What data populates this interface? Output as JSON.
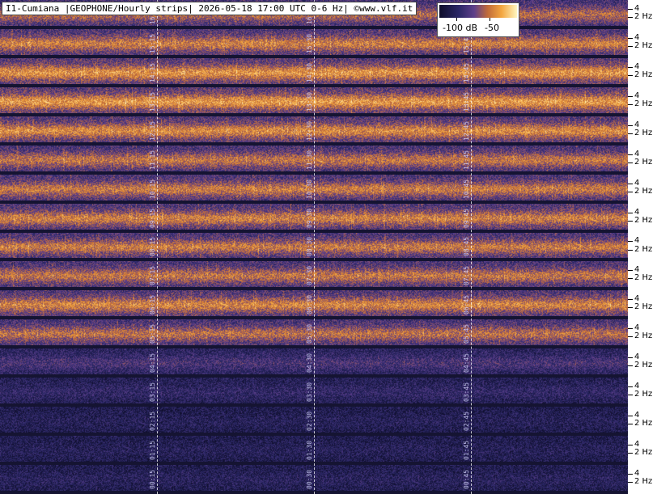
{
  "title": "I1-Cumiana |GEOPHONE/Hourly strips| 2026-05-18 17:00 UTC 0-6 Hz| ©www.vlf.it",
  "colorbar": {
    "tick_labels": [
      "-100 dB",
      "-50"
    ]
  },
  "chart_data": {
    "type": "heatmap",
    "title": "I1-Cumiana |GEOPHONE/Hourly strips| 2026-05-18 17:00 UTC 0-6 Hz| ©www.vlf.it",
    "ylabel": "Hz",
    "y_tick_labels": [
      "4",
      "2 Hz"
    ],
    "y_range": [
      0,
      6
    ],
    "colorbar": {
      "range_db": [
        -110,
        -40
      ],
      "tick_labels": [
        "-100 dB",
        "-50"
      ]
    },
    "strips": [
      {
        "hour": "16",
        "minute_labels": [
          "16:15",
          "16:30",
          "16:45"
        ],
        "activity": 0.62
      },
      {
        "hour": "15",
        "minute_labels": [
          "15:15",
          "15:30",
          "15:45"
        ],
        "activity": 0.7
      },
      {
        "hour": "14",
        "minute_labels": [
          "14:15",
          "14:30",
          "14:45"
        ],
        "activity": 0.78
      },
      {
        "hour": "13",
        "minute_labels": [
          "13:15",
          "13:30",
          "13:45"
        ],
        "activity": 0.8
      },
      {
        "hour": "12",
        "minute_labels": [
          "12:15",
          "12:30",
          "12:45"
        ],
        "activity": 0.74
      },
      {
        "hour": "11",
        "minute_labels": [
          "11:15",
          "11:30",
          "11:45"
        ],
        "activity": 0.66
      },
      {
        "hour": "10",
        "minute_labels": [
          "10:15",
          "10:30",
          "10:45"
        ],
        "activity": 0.68
      },
      {
        "hour": "09",
        "minute_labels": [
          "09:15",
          "09:30",
          "09:45"
        ],
        "activity": 0.7
      },
      {
        "hour": "08",
        "minute_labels": [
          "08:15",
          "08:30",
          "08:45"
        ],
        "activity": 0.68
      },
      {
        "hour": "07",
        "minute_labels": [
          "07:15",
          "07:30",
          "07:45"
        ],
        "activity": 0.66
      },
      {
        "hour": "06",
        "minute_labels": [
          "06:15",
          "06:30",
          "06:45"
        ],
        "activity": 0.72
      },
      {
        "hour": "05",
        "minute_labels": [
          "05:15",
          "05:30",
          "05:45"
        ],
        "activity": 0.64
      },
      {
        "hour": "04",
        "minute_labels": [
          "04:15",
          "04:30",
          "04:45"
        ],
        "activity": 0.3
      },
      {
        "hour": "03",
        "minute_labels": [
          "03:15",
          "03:30",
          "03:45"
        ],
        "activity": 0.18
      },
      {
        "hour": "02",
        "minute_labels": [
          "02:15",
          "02:30",
          "02:45"
        ],
        "activity": 0.1
      },
      {
        "hour": "01",
        "minute_labels": [
          "01:15",
          "01:30",
          "01:45"
        ],
        "activity": 0.1
      },
      {
        "hour": "00",
        "minute_labels": [
          "00:15",
          "00:30",
          "00:45"
        ],
        "activity": 0.12
      }
    ]
  }
}
